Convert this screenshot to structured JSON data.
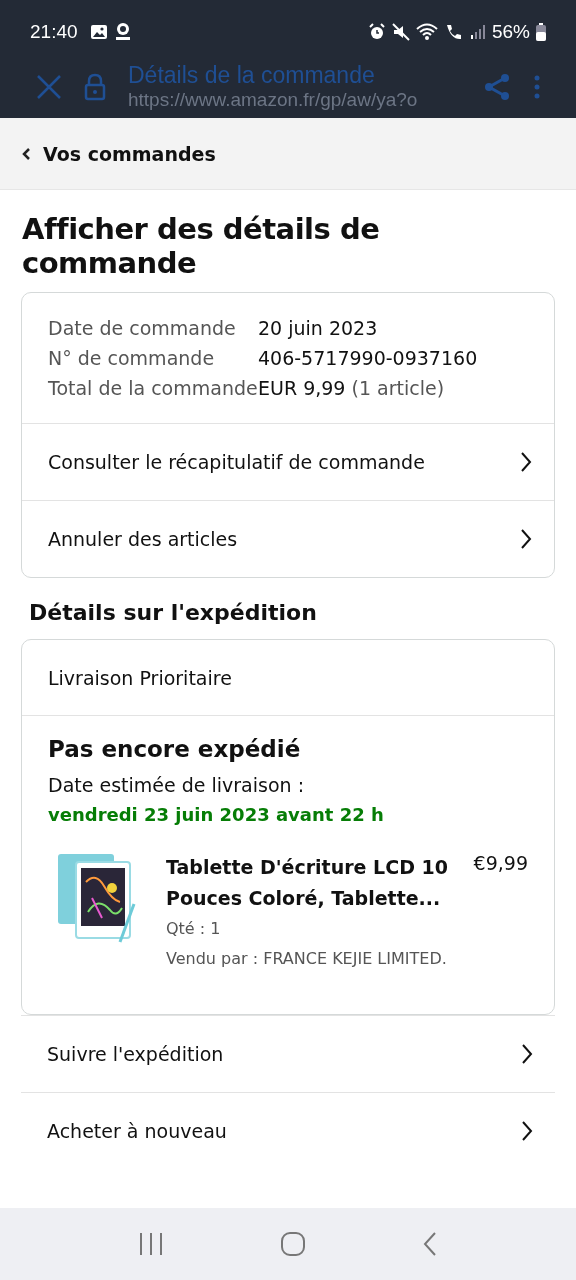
{
  "status_bar": {
    "time": "21:40",
    "battery": "56%"
  },
  "browser": {
    "title": "Détails de la commande",
    "url": "https://www.amazon.fr/gp/aw/ya?o"
  },
  "back_link": "Vos commandes",
  "page_title": "Afficher des détails de commande",
  "order_summary": {
    "rows": [
      {
        "label": "Date de commande",
        "value": "20 juin 2023"
      },
      {
        "label": "N° de commande",
        "value": "406-5717990-0937160"
      },
      {
        "label": "Total de la commande",
        "value": "EUR 9,99",
        "note": "(1 article)"
      }
    ],
    "links": [
      "Consulter le récapitulatif de commande",
      "Annuler des articles"
    ]
  },
  "shipment_heading": "Détails sur l'expédition",
  "shipment": {
    "method": "Livraison Prioritaire",
    "status": "Pas encore expédié",
    "estimate_label": "Date estimée de livraison :",
    "estimate_date": "vendredi 23 juin 2023 avant 22 h",
    "items": [
      {
        "kind": "picture",
        "title": "Tablette D'écriture LCD 10 Pouces Coloré, Tablette...",
        "price": "€9,99",
        "qty": "Qté : 1",
        "seller": "Vendu par : FRANCE KEJIE LIMITED."
      }
    ]
  },
  "actions": [
    "Suivre l'expédition",
    "Acheter à nouveau"
  ]
}
